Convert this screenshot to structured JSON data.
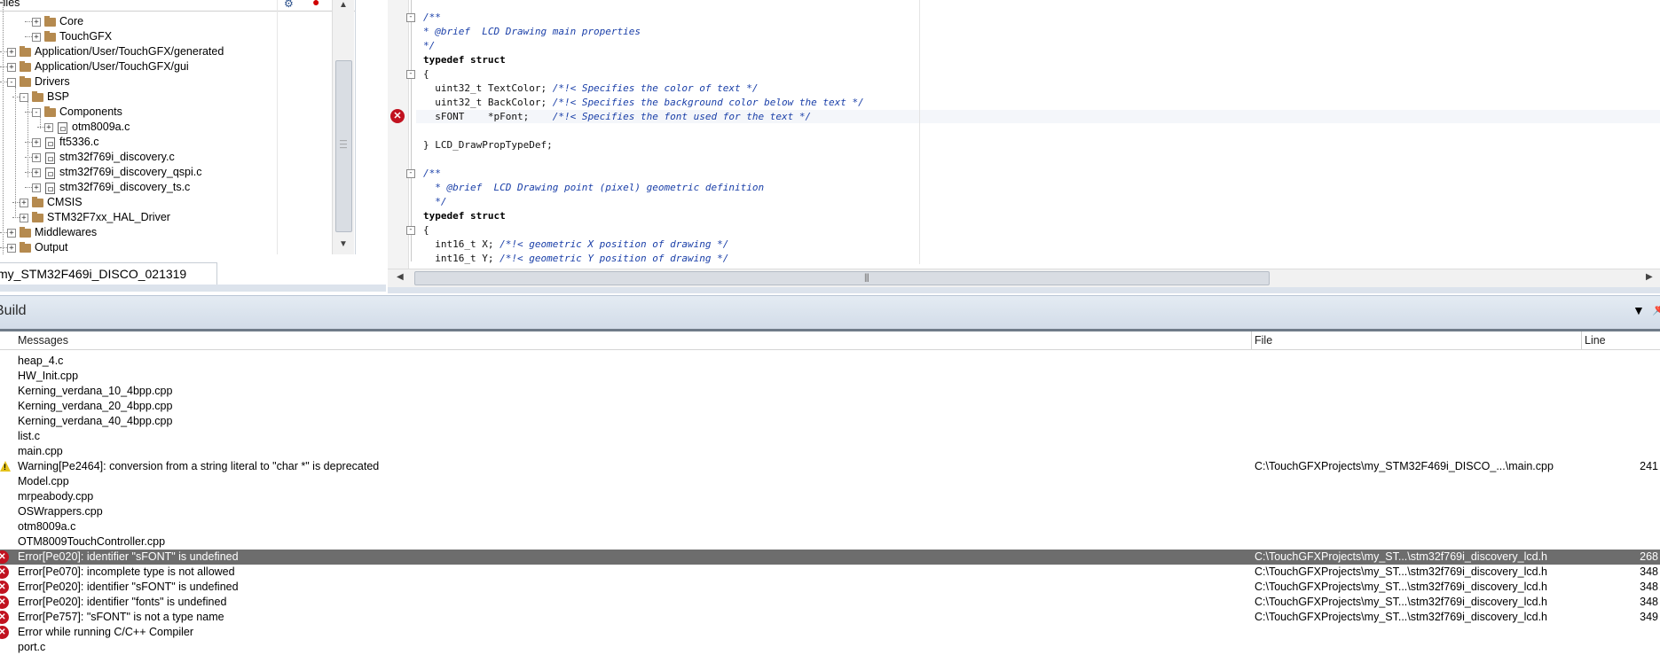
{
  "workspace": {
    "files_title": "Files",
    "workspace_tab": "my_STM32F469i_DISCO_021319",
    "tree": [
      {
        "label": "Core",
        "level": 2,
        "type": "folder",
        "state": "+"
      },
      {
        "label": "TouchGFX",
        "level": 2,
        "type": "folder",
        "state": "+"
      },
      {
        "label": "Application/User/TouchGFX/generated",
        "level": 0,
        "type": "folder",
        "state": "+"
      },
      {
        "label": "Application/User/TouchGFX/gui",
        "level": 0,
        "type": "folder",
        "state": "+"
      },
      {
        "label": "Drivers",
        "level": 0,
        "type": "folder",
        "state": "-"
      },
      {
        "label": "BSP",
        "level": 1,
        "type": "folder",
        "state": "-"
      },
      {
        "label": "Components",
        "level": 2,
        "type": "folder",
        "state": "-"
      },
      {
        "label": "otm8009a.c",
        "level": 3,
        "type": "file",
        "state": "+"
      },
      {
        "label": "ft5336.c",
        "level": 2,
        "type": "file",
        "state": "+"
      },
      {
        "label": "stm32f769i_discovery.c",
        "level": 2,
        "type": "file",
        "state": "+"
      },
      {
        "label": "stm32f769i_discovery_qspi.c",
        "level": 2,
        "type": "file",
        "state": "+"
      },
      {
        "label": "stm32f769i_discovery_ts.c",
        "level": 2,
        "type": "file",
        "state": "+"
      },
      {
        "label": "CMSIS",
        "level": 1,
        "type": "folder",
        "state": "+"
      },
      {
        "label": "STM32F7xx_HAL_Driver",
        "level": 1,
        "type": "folder",
        "state": "+"
      },
      {
        "label": "Middlewares",
        "level": 0,
        "type": "folder",
        "state": "+"
      },
      {
        "label": "Output",
        "level": 0,
        "type": "folder",
        "state": "+"
      }
    ]
  },
  "editor": {
    "lines": [
      {
        "fold": "-",
        "parts": [
          {
            "c": "cmt",
            "t": "/**"
          }
        ]
      },
      {
        "fold": "",
        "parts": [
          {
            "c": "cmt",
            "t": "* @brief  LCD Drawing main properties"
          }
        ]
      },
      {
        "fold": "",
        "parts": [
          {
            "c": "cmt",
            "t": "*/"
          }
        ]
      },
      {
        "fold": "",
        "parts": [
          {
            "c": "kw",
            "t": "typedef struct"
          }
        ]
      },
      {
        "fold": "-",
        "parts": [
          {
            "c": "norm",
            "t": "{"
          }
        ]
      },
      {
        "fold": "",
        "parts": [
          {
            "c": "norm",
            "t": "  uint32_t TextColor; "
          },
          {
            "c": "cmt",
            "t": "/*!< Specifies the color of text */"
          }
        ]
      },
      {
        "fold": "",
        "parts": [
          {
            "c": "norm",
            "t": "  uint32_t BackColor; "
          },
          {
            "c": "cmt",
            "t": "/*!< Specifies the background color below the text */"
          }
        ]
      },
      {
        "fold": "",
        "parts": [
          {
            "c": "norm",
            "t": "  sFONT    *pFont;    "
          },
          {
            "c": "cmt",
            "t": "/*!< Specifies the font used for the text */"
          }
        ]
      },
      {
        "fold": "",
        "parts": [
          {
            "c": "norm",
            "t": ""
          }
        ]
      },
      {
        "fold": "",
        "parts": [
          {
            "c": "norm",
            "t": "} LCD_DrawPropTypeDef;"
          }
        ]
      },
      {
        "fold": "",
        "parts": [
          {
            "c": "norm",
            "t": ""
          }
        ]
      },
      {
        "fold": "-",
        "parts": [
          {
            "c": "cmt",
            "t": "/**"
          }
        ]
      },
      {
        "fold": "",
        "parts": [
          {
            "c": "cmt",
            "t": "  * @brief  LCD Drawing point (pixel) geometric definition"
          }
        ]
      },
      {
        "fold": "",
        "parts": [
          {
            "c": "cmt",
            "t": "  */"
          }
        ]
      },
      {
        "fold": "",
        "parts": [
          {
            "c": "kw",
            "t": "typedef struct"
          }
        ]
      },
      {
        "fold": "-",
        "parts": [
          {
            "c": "norm",
            "t": "{"
          }
        ]
      },
      {
        "fold": "",
        "parts": [
          {
            "c": "norm",
            "t": "  int16_t X; "
          },
          {
            "c": "cmt",
            "t": "/*!< geometric X position of drawing */"
          }
        ]
      },
      {
        "fold": "",
        "parts": [
          {
            "c": "norm",
            "t": "  int16_t Y; "
          },
          {
            "c": "cmt",
            "t": "/*!< geometric Y position of drawing */"
          }
        ]
      }
    ]
  },
  "build": {
    "title": "Build",
    "columns": {
      "messages": "Messages",
      "file": "File",
      "line": "Line"
    },
    "rows": [
      {
        "icon": "",
        "text": "heap_4.c",
        "file": "",
        "line": ""
      },
      {
        "icon": "",
        "text": "HW_Init.cpp",
        "file": "",
        "line": ""
      },
      {
        "icon": "",
        "text": "Kerning_verdana_10_4bpp.cpp",
        "file": "",
        "line": ""
      },
      {
        "icon": "",
        "text": "Kerning_verdana_20_4bpp.cpp",
        "file": "",
        "line": ""
      },
      {
        "icon": "",
        "text": "Kerning_verdana_40_4bpp.cpp",
        "file": "",
        "line": ""
      },
      {
        "icon": "",
        "text": "list.c",
        "file": "",
        "line": ""
      },
      {
        "icon": "",
        "text": "main.cpp",
        "file": "",
        "line": ""
      },
      {
        "icon": "warn",
        "text": "Warning[Pe2464]: conversion from a string literal to \"char *\" is deprecated",
        "file": "C:\\TouchGFXProjects\\my_STM32F469i_DISCO_...\\main.cpp",
        "line": "241"
      },
      {
        "icon": "",
        "text": "Model.cpp",
        "file": "",
        "line": ""
      },
      {
        "icon": "",
        "text": "mrpeabody.cpp",
        "file": "",
        "line": ""
      },
      {
        "icon": "",
        "text": "OSWrappers.cpp",
        "file": "",
        "line": ""
      },
      {
        "icon": "",
        "text": "otm8009a.c",
        "file": "",
        "line": ""
      },
      {
        "icon": "",
        "text": "OTM8009TouchController.cpp",
        "file": "",
        "line": ""
      },
      {
        "icon": "err",
        "text": "Error[Pe020]: identifier \"sFONT\" is undefined",
        "file": "C:\\TouchGFXProjects\\my_ST...\\stm32f769i_discovery_lcd.h",
        "line": "268",
        "selected": true
      },
      {
        "icon": "err",
        "text": "Error[Pe070]: incomplete type is not allowed",
        "file": "C:\\TouchGFXProjects\\my_ST...\\stm32f769i_discovery_lcd.h",
        "line": "348"
      },
      {
        "icon": "err",
        "text": "Error[Pe020]: identifier \"sFONT\" is undefined",
        "file": "C:\\TouchGFXProjects\\my_ST...\\stm32f769i_discovery_lcd.h",
        "line": "348"
      },
      {
        "icon": "err",
        "text": "Error[Pe020]: identifier \"fonts\" is undefined",
        "file": "C:\\TouchGFXProjects\\my_ST...\\stm32f769i_discovery_lcd.h",
        "line": "348"
      },
      {
        "icon": "err",
        "text": "Error[Pe757]: \"sFONT\" is not a type name",
        "file": "C:\\TouchGFXProjects\\my_ST...\\stm32f769i_discovery_lcd.h",
        "line": "349"
      },
      {
        "icon": "err",
        "text": "Error while running C/C++ Compiler",
        "file": "",
        "line": ""
      },
      {
        "icon": "",
        "text": "port.c",
        "file": "",
        "line": ""
      }
    ]
  }
}
